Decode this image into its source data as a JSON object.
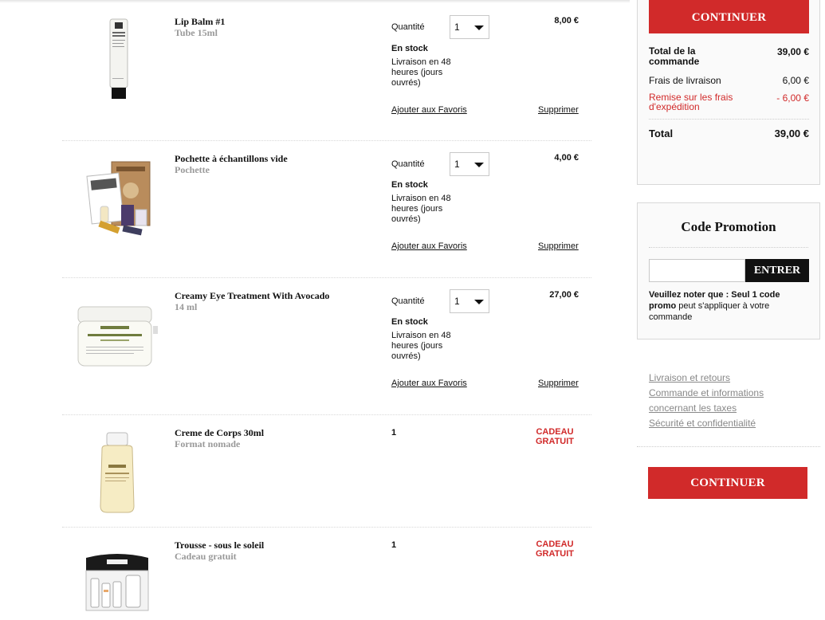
{
  "cart": {
    "quantity_label": "Quantité",
    "stock_label": "En stock",
    "delivery_text": "Livraison en 48 heures (jours ouvrés)",
    "favorites_label": "Ajouter aux Favoris",
    "delete_label": "Supprimer",
    "gift_label": "CADEAU GRATUIT",
    "items": [
      {
        "name": "Lip Balm #1",
        "subtitle": "Tube 15ml",
        "quantity": "1",
        "price": "8,00 €"
      },
      {
        "name": "Pochette à échantillons vide",
        "subtitle": "Pochette",
        "quantity": "1",
        "price": "4,00 €"
      },
      {
        "name": "Creamy Eye Treatment With Avocado",
        "subtitle": "14 ml",
        "quantity": "1",
        "price": "27,00 €"
      },
      {
        "name": "Creme de Corps 30ml",
        "subtitle": "Format nomade",
        "quantity": "1"
      },
      {
        "name": "Trousse - sous le soleil",
        "subtitle": "Cadeau gratuit",
        "quantity": "1"
      }
    ]
  },
  "summary": {
    "continue_label": "CONTINUER",
    "order_total_label": "Total de la commande",
    "order_total_value": "39,00 €",
    "shipping_label": "Frais de livraison",
    "shipping_value": "6,00 €",
    "discount_label": "Remise sur les frais d'expédition",
    "discount_value": "- 6,00 €",
    "total_label": "Total",
    "total_value": "39,00 €"
  },
  "promo": {
    "title": "Code Promotion",
    "input_value": "",
    "button_label": "ENTRER",
    "note_bold": "Veuillez noter que : Seul 1 code promo",
    "note_rest": " peut s'appliquer à votre commande"
  },
  "links": [
    "Livraison et retours",
    "Commande et informations",
    "concernant les taxes",
    "Sécurité et confidentialité"
  ],
  "bottom_continue_label": "CONTINUER",
  "colors": {
    "accent_red": "#d12a2a",
    "enter_button": "#111111",
    "panel_bg": "#fafafa",
    "link_gray": "#888888"
  }
}
